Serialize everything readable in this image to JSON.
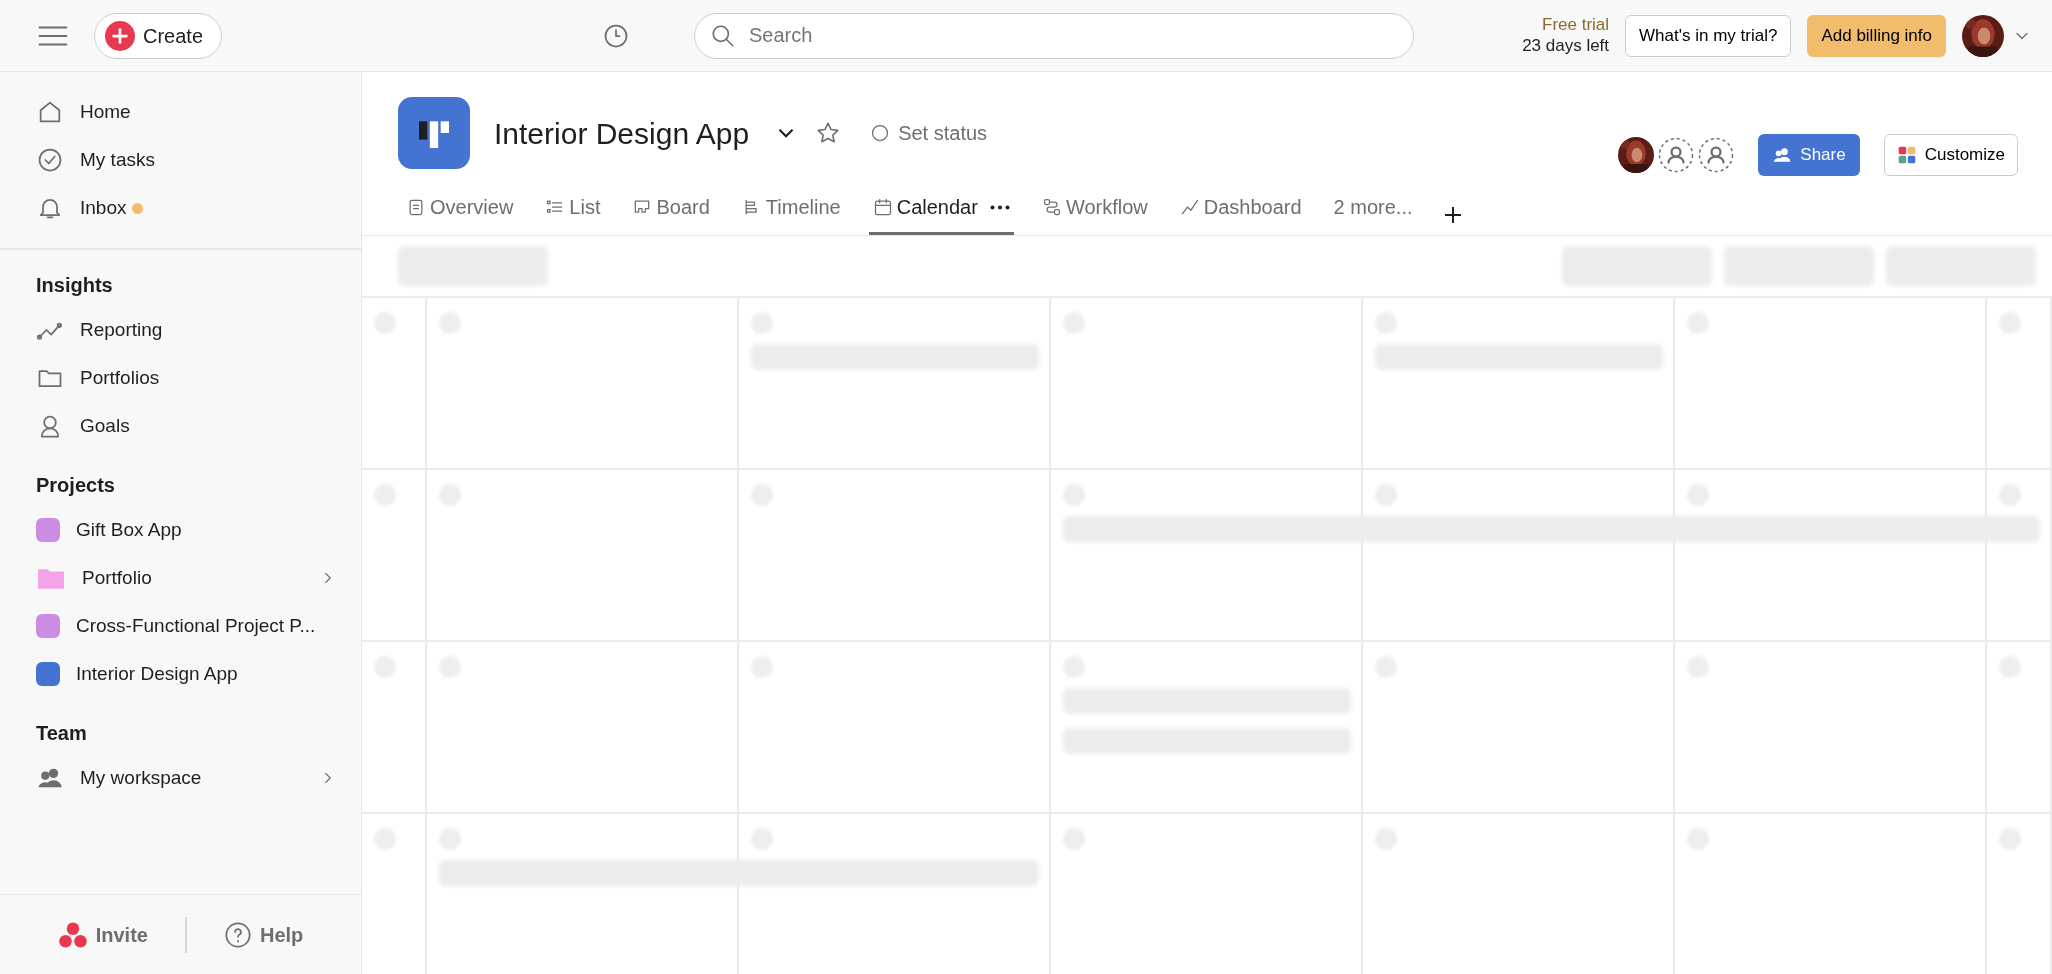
{
  "top_bar": {
    "create_button": "Create",
    "search": {
      "placeholder": "Search"
    },
    "trial_label": "Free trial",
    "trial_days": "23 days left",
    "trial_button": "What's in my trial?",
    "billing_button": "Add billing info"
  },
  "sidebar": {
    "nav": [
      {
        "kind": "home",
        "label": "Home",
        "unread": false
      },
      {
        "kind": "tasks",
        "label": "My tasks",
        "unread": false
      },
      {
        "kind": "inbox",
        "label": "Inbox",
        "unread": true
      }
    ],
    "sections": [
      {
        "title": "Insights",
        "items": [
          {
            "kind": "reporting",
            "label": "Reporting",
            "expandable": false
          },
          {
            "kind": "portfolios",
            "label": "Portfolios",
            "expandable": false
          },
          {
            "kind": "goals",
            "label": "Goals",
            "expandable": false
          }
        ]
      },
      {
        "title": "Projects",
        "items": [
          {
            "kind": "project",
            "label": "Gift Box App",
            "color": "#cd8ce3",
            "expandable": false
          },
          {
            "kind": "folder",
            "label": "Portfolio",
            "color": "#f5a3e8",
            "expandable": true
          },
          {
            "kind": "project",
            "label": "Cross-Functional Project P...",
            "color": "#cd8ce3",
            "expandable": false
          },
          {
            "kind": "project",
            "label": "Interior Design App",
            "color": "#4573d2",
            "expandable": false
          }
        ]
      },
      {
        "title": "Team",
        "items": [
          {
            "kind": "team",
            "label": "My workspace",
            "expandable": true
          }
        ]
      }
    ],
    "invite": "Invite",
    "help": "Help"
  },
  "project": {
    "title": "Interior Design App",
    "status": "Set status",
    "share_button": "Share",
    "customize_button": "Customize",
    "tabs": [
      {
        "kind": "overview",
        "label": "Overview",
        "selected": false
      },
      {
        "kind": "list",
        "label": "List",
        "selected": false
      },
      {
        "kind": "board",
        "label": "Board",
        "selected": false
      },
      {
        "kind": "timeline",
        "label": "Timeline",
        "selected": false
      },
      {
        "kind": "calendar",
        "label": "Calendar",
        "selected": true
      },
      {
        "kind": "workflow",
        "label": "Workflow",
        "selected": false
      },
      {
        "kind": "dashboard",
        "label": "Dashboard",
        "selected": false
      },
      {
        "kind": "more",
        "label": "2 more...",
        "selected": false
      }
    ]
  }
}
